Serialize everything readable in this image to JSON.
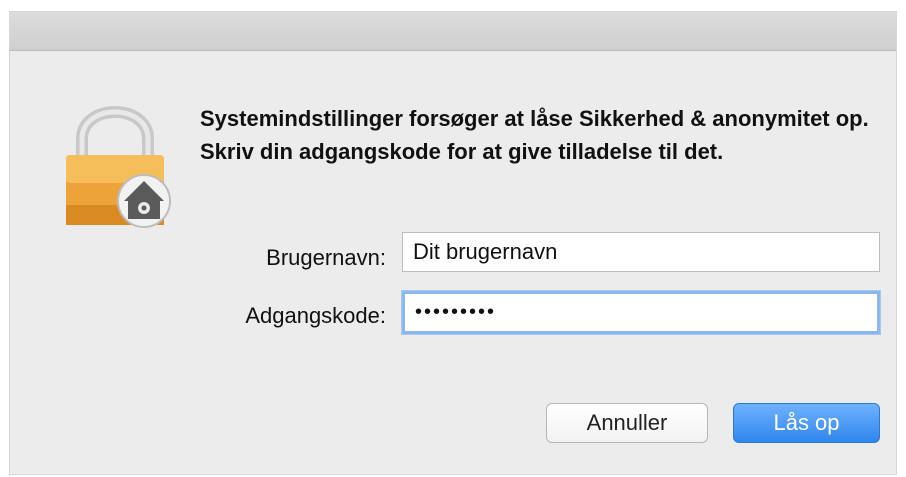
{
  "dialog": {
    "message": "Systemindstillinger forsøger at låse Sikkerhed & anonymitet op. Skriv din adgangskode for at give tilladelse til det.",
    "icon": "lock-with-house-icon"
  },
  "form": {
    "username_label": "Brugernavn:",
    "username_value": "Dit brugernavn",
    "password_label": "Adgangskode:",
    "password_value": "•••••••••"
  },
  "buttons": {
    "cancel_label": "Annuller",
    "unlock_label": "Lås op"
  },
  "colors": {
    "accent": "#3a8df0",
    "lock_body": "#f0a43a"
  }
}
